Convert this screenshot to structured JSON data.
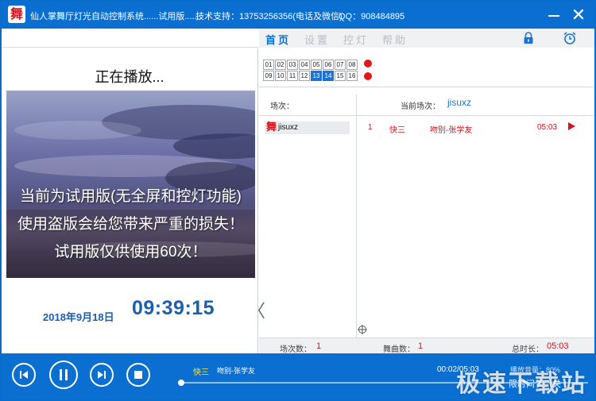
{
  "titlebar": {
    "logo_char": "舞",
    "title": "仙人掌舞厅灯光自动控制系统......试用版......",
    "support": "技术支持：13753256356(电话及微信)",
    "qq": "QQ：908484895"
  },
  "menu": {
    "items": [
      "首页",
      "设置",
      "控灯",
      "帮助"
    ],
    "active_index": 0,
    "lock_icon": "lock-icon",
    "alarm_icon": "alarm-clock-icon"
  },
  "left": {
    "playing_label": "正在播放...",
    "cover_lines": [
      "当前为试用版(无全屏和控灯功能)",
      "使用盗版会给您带来严重的损失！",
      "试用版仅供使用60次！"
    ],
    "date": "2018年9月18日",
    "clock": "09:39:15",
    "collapse_glyph": "〈"
  },
  "grid": {
    "row1": [
      "01",
      "02",
      "03",
      "04",
      "05",
      "06",
      "07",
      "08"
    ],
    "row2": [
      "09",
      "10",
      "11",
      "12",
      "13",
      "14",
      "15",
      "16"
    ],
    "active": [
      "13",
      "14"
    ]
  },
  "scenes": {
    "header": "场次：",
    "current_label": "当前场次：",
    "current_value": "jisuxz",
    "items": [
      {
        "icon": "舞",
        "name": "jisuxz"
      }
    ]
  },
  "songs": [
    {
      "index": "1",
      "type": "快三",
      "title": "吻别-张学友",
      "duration": "05:03"
    }
  ],
  "stats": {
    "scene_count_label": "场次数：",
    "scene_count": "1",
    "song_count_label": "舞曲数：",
    "song_count": "1",
    "total_label": "总时长：",
    "total": "05:03"
  },
  "player": {
    "now_type": "快三",
    "now_title": "吻别-张学友",
    "time": "00:02/05:03",
    "volume_text": "播放音量：80%",
    "timer_text": "限时间长：关",
    "progress": 0.01
  },
  "watermark": "极速下载站",
  "colors": {
    "titlebar": "#0a6fd1",
    "accent_blue": "#1b5fae",
    "song_red": "#d3141c",
    "now_yellow": "#ffe33d"
  }
}
